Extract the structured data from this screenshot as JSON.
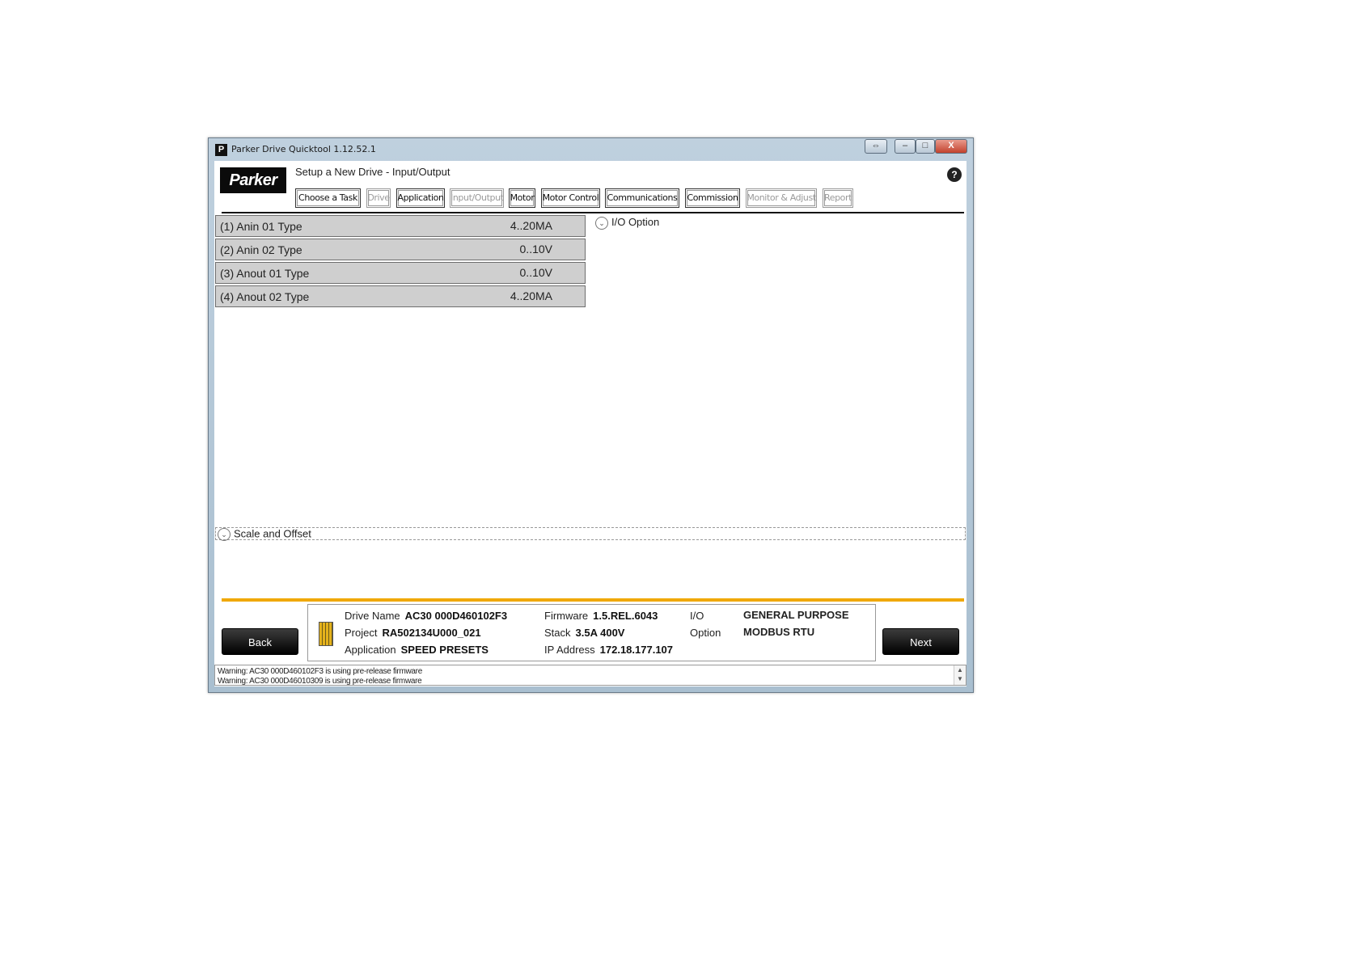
{
  "window": {
    "title": "Parker Drive Quicktool 1.12.52.1",
    "logo_glyph": "P",
    "controls": {
      "restore": "⇔",
      "minimize": "–",
      "maximize": "□",
      "close": "X"
    }
  },
  "header": {
    "logo": "Parker",
    "page_title": "Setup a New Drive - Input/Output",
    "help": "?"
  },
  "steps": [
    {
      "label": "Choose a Task",
      "enabled": true
    },
    {
      "label": "Drive",
      "enabled": false
    },
    {
      "label": "Application",
      "enabled": true
    },
    {
      "label": "Input/Output",
      "enabled": false
    },
    {
      "label": "Motor",
      "enabled": true
    },
    {
      "label": "Motor Control",
      "enabled": true
    },
    {
      "label": "Communications",
      "enabled": true
    },
    {
      "label": "Commission",
      "enabled": true
    },
    {
      "label": "Monitor & Adjust",
      "enabled": false
    },
    {
      "label": "Report",
      "enabled": false
    }
  ],
  "params": [
    {
      "label": "(1) Anin 01 Type",
      "value": "4..20MA"
    },
    {
      "label": "(2) Anin 02 Type",
      "value": "0..10V"
    },
    {
      "label": "(3) Anout 01 Type",
      "value": "0..10V"
    },
    {
      "label": "(4) Anout 02 Type",
      "value": "4..20MA"
    }
  ],
  "sections": {
    "io_option": "I/O Option",
    "scale_offset": "Scale and Offset",
    "chevron": "⌄"
  },
  "buttons": {
    "back": "Back",
    "next": "Next"
  },
  "drive_info": {
    "drive_name_label": "Drive Name",
    "drive_name": "AC30 000D460102F3",
    "project_label": "Project",
    "project": "RA502134U000_021",
    "application_label": "Application",
    "application": "SPEED PRESETS",
    "firmware_label": "Firmware",
    "firmware": "1.5.REL.6043",
    "stack_label": "Stack",
    "stack": "3.5A 400V",
    "ip_label": "IP Address",
    "ip": "172.18.177.107",
    "io_label": "I/O",
    "io": "GENERAL PURPOSE",
    "option_label": "Option",
    "option": "MODBUS RTU"
  },
  "log": [
    "Warning: AC30 000D460102F3 is using pre-release firmware",
    "Warning: AC30 000D46010309 is using pre-release firmware"
  ],
  "colors": {
    "accent_orange": "#f0a800",
    "button_black": "#000000"
  }
}
